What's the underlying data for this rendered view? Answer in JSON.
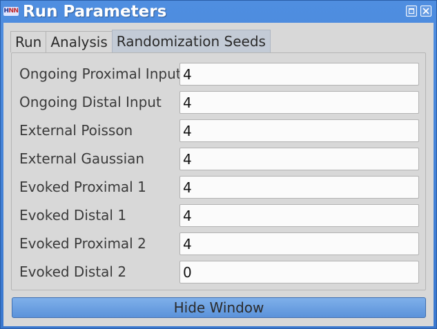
{
  "window": {
    "title": "Run Parameters",
    "logo_text_a": "H",
    "logo_text_b": "NN"
  },
  "tabs": [
    {
      "label": "Run",
      "active": false
    },
    {
      "label": "Analysis",
      "active": false
    },
    {
      "label": "Randomization Seeds",
      "active": true
    }
  ],
  "seeds": [
    {
      "label": "Ongoing Proximal Input",
      "value": "4"
    },
    {
      "label": "Ongoing Distal Input",
      "value": "4"
    },
    {
      "label": "External Poisson",
      "value": "4"
    },
    {
      "label": "External Gaussian",
      "value": "4"
    },
    {
      "label": "Evoked Proximal 1",
      "value": "4"
    },
    {
      "label": "Evoked Distal 1",
      "value": "4"
    },
    {
      "label": "Evoked Proximal 2",
      "value": "4"
    },
    {
      "label": "Evoked Distal 2",
      "value": "0"
    }
  ],
  "hide_button": {
    "label": "Hide Window"
  },
  "icons": {
    "maximize": "maximize-icon",
    "close": "close-icon",
    "app": "app-logo-icon"
  },
  "colors": {
    "titlebar": "#3a78cf",
    "active_tab": "#c3cbd6",
    "button": "#6a9fe1"
  }
}
